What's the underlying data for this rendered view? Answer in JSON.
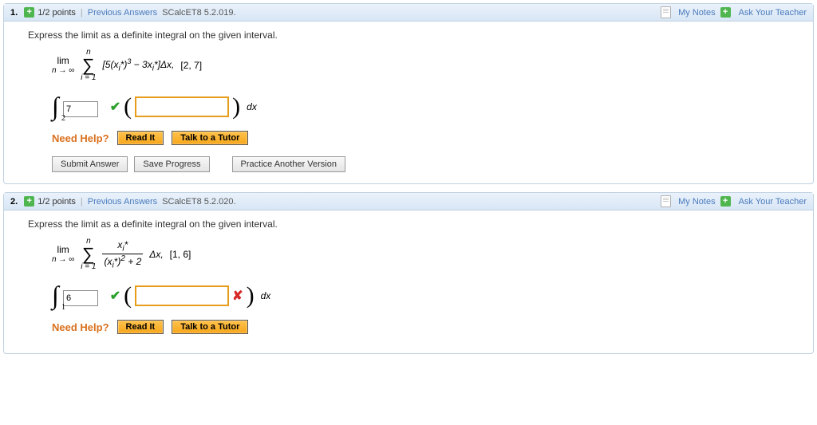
{
  "questions": [
    {
      "number": "1.",
      "points": "1/2 points",
      "prev": "Previous Answers",
      "source": "SCalcET8 5.2.019.",
      "mynotes": "My Notes",
      "ask": "Ask Your Teacher",
      "prompt": "Express the limit as a definite integral on the given interval.",
      "lim_top": "lim",
      "lim_bot": "n → ∞",
      "sigma_top": "n",
      "sigma_bot": "i = 1",
      "expr_html": "[5(x_i*)^3 − 3x_i*]Δx,",
      "interval": "[2, 7]",
      "upper_value": "7",
      "upper_status": "check",
      "lower_bound": "2",
      "integrand_value": "",
      "integrand_status": "",
      "dx": "dx",
      "need_help": "Need Help?",
      "read_it": "Read It",
      "talk": "Talk to a Tutor",
      "submit": "Submit Answer",
      "save": "Save Progress",
      "practice": "Practice Another Version"
    },
    {
      "number": "2.",
      "points": "1/2 points",
      "prev": "Previous Answers",
      "source": "SCalcET8 5.2.020.",
      "mynotes": "My Notes",
      "ask": "Ask Your Teacher",
      "prompt": "Express the limit as a definite integral on the given interval.",
      "lim_top": "lim",
      "lim_bot": "n → ∞",
      "sigma_top": "n",
      "sigma_bot": "i = 1",
      "frac_num": "x_i*",
      "frac_den": "(x_i*)^2 + 2",
      "after_frac": "Δx,",
      "interval": "[1, 6]",
      "upper_value": "6",
      "upper_status": "check",
      "lower_bound": "1",
      "integrand_value": "",
      "integrand_status": "cross",
      "dx": "dx",
      "need_help": "Need Help?",
      "read_it": "Read It",
      "talk": "Talk to a Tutor"
    }
  ]
}
